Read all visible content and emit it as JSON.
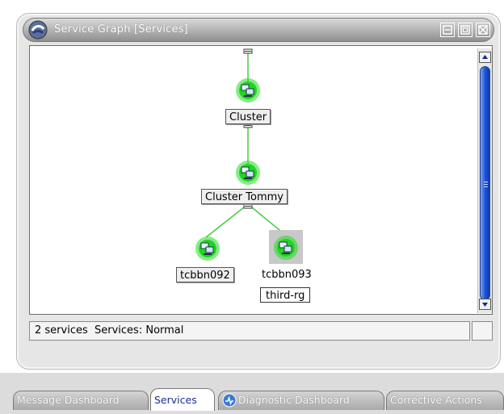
{
  "window": {
    "title": "Service Graph [Services]",
    "controls": [
      "minimize-icon",
      "maximize-icon",
      "close-icon"
    ]
  },
  "graph": {
    "nodes": [
      {
        "label": "Cluster",
        "status": "normal",
        "icon": "service-computers-icon"
      },
      {
        "label": "Cluster Tommy",
        "status": "normal",
        "icon": "service-computers-icon"
      },
      {
        "label": "tcbbn092",
        "status": "normal",
        "icon": "service-computers-icon"
      },
      {
        "label": "tcbbn093",
        "sublabel": "third-rg",
        "status": "normal",
        "selected": true,
        "icon": "service-computers-icon"
      }
    ],
    "status_color": "#22dd22",
    "edge_color": "#44cc44"
  },
  "status": {
    "text": "2 services  Services: Normal"
  },
  "tabs": [
    {
      "label": "Message Dashboard",
      "active": false
    },
    {
      "label": "Services",
      "active": true
    },
    {
      "label": "Diagnostic Dashboard",
      "active": false,
      "icon": "diagnostic-icon"
    },
    {
      "label": "Corrective Actions",
      "active": false
    }
  ]
}
